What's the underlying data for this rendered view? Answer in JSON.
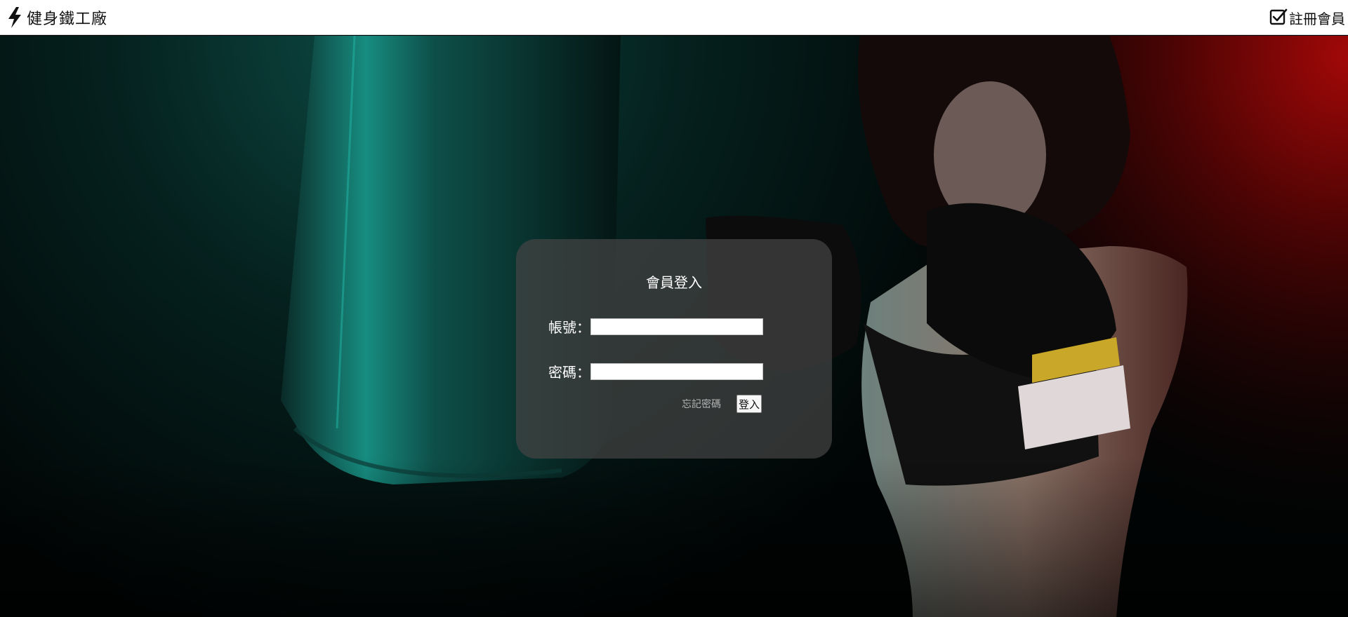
{
  "navbar": {
    "brand_icon": "lightning-bolt-icon",
    "brand_name": "健身鐵工廠",
    "register_icon": "checkbox-icon",
    "register_label": "註冊會員"
  },
  "login": {
    "title": "會員登入",
    "account_label": "帳號：",
    "account_value": "",
    "password_label": "密碼：",
    "password_value": "",
    "forgot_password_label": "忘記密碼",
    "submit_label": "登入"
  },
  "colors": {
    "navbar_bg": "#ffffff",
    "panel_bg": "rgba(68,68,68,0.72)",
    "teal_light": "#0f9e90",
    "red_light": "#a20808"
  }
}
